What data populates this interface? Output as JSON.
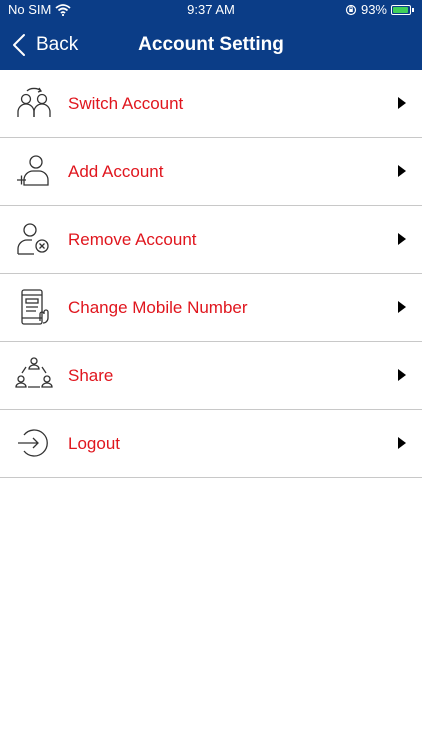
{
  "status_bar": {
    "carrier": "No SIM",
    "time": "9:37 AM",
    "battery": "93%",
    "battery_level": 0.93
  },
  "header": {
    "back_label": "Back",
    "title": "Account Setting",
    "background_color": "#0b3d87"
  },
  "menu": {
    "accent_color": "#e0161e",
    "items": [
      {
        "label": "Switch Account",
        "icon": "switch-account-icon"
      },
      {
        "label": "Add Account",
        "icon": "add-account-icon"
      },
      {
        "label": "Remove Account",
        "icon": "remove-account-icon"
      },
      {
        "label": "Change Mobile Number",
        "icon": "mobile-phone-icon"
      },
      {
        "label": "Share",
        "icon": "share-icon"
      },
      {
        "label": "Logout",
        "icon": "logout-icon"
      }
    ]
  }
}
